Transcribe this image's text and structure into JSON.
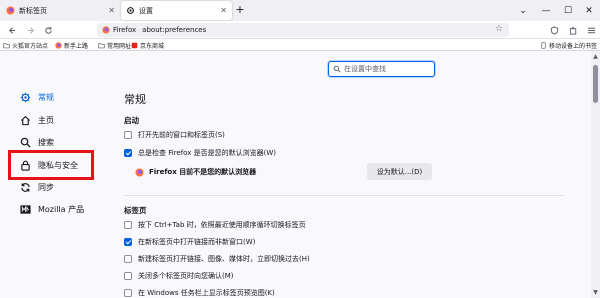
{
  "tabs": [
    {
      "label": "新标签页",
      "icon": "firefox-icon"
    },
    {
      "label": "设置",
      "icon": "gear-icon"
    }
  ],
  "navbar": {
    "brand": "Firefox",
    "url": "about:preferences"
  },
  "bookmarks": [
    {
      "label": "火狐官方站点",
      "icon": "firefox-icon"
    },
    {
      "label": "新手上路",
      "icon": "firefox-icon"
    },
    {
      "label": "常用网址",
      "icon": "folder-icon"
    },
    {
      "label": "京东商城",
      "icon": "jd-icon"
    }
  ],
  "mobile_bookmarks": "移动设备上的书签",
  "search": {
    "placeholder": "在设置中查找"
  },
  "sidebar": {
    "items": [
      {
        "label": "常规",
        "icon": "gear-icon",
        "active": true
      },
      {
        "label": "主页",
        "icon": "home-icon",
        "active": false
      },
      {
        "label": "搜索",
        "icon": "search-icon",
        "active": false
      },
      {
        "label": "隐私与安全",
        "icon": "lock-icon",
        "active": false
      },
      {
        "label": "同步",
        "icon": "sync-icon",
        "active": false
      },
      {
        "label": "Mozilla 产品",
        "icon": "mozilla-icon",
        "active": false
      }
    ]
  },
  "main": {
    "heading": "常规",
    "startup": {
      "title": "启动",
      "options": [
        {
          "label": "打开先前的窗口和标签页(S)",
          "checked": false
        },
        {
          "label": "总是检查 Firefox 是否是您的默认浏览器(W)",
          "checked": true
        }
      ],
      "default_status": "Firefox 目前不是您的默认浏览器",
      "set_default_button": "设为默认...(D)"
    },
    "tabs_section": {
      "title": "标签页",
      "options": [
        {
          "label": "按下 Ctrl+Tab 时，依照最近使用顺序循环切换标签页",
          "checked": false
        },
        {
          "label": "在新标签页中打开链接而非新窗口(W)",
          "checked": true
        },
        {
          "label": "新建标签页打开链接、图像、媒体时，立即切换过去(H)",
          "checked": false
        },
        {
          "label": "关闭多个标签页时向您确认(M)",
          "checked": false
        },
        {
          "label": "在 Windows 任务栏上显示标签页预览图(K)",
          "checked": false
        }
      ]
    }
  },
  "colors": {
    "accent": "#0061e0",
    "highlight": "#e5131a"
  }
}
